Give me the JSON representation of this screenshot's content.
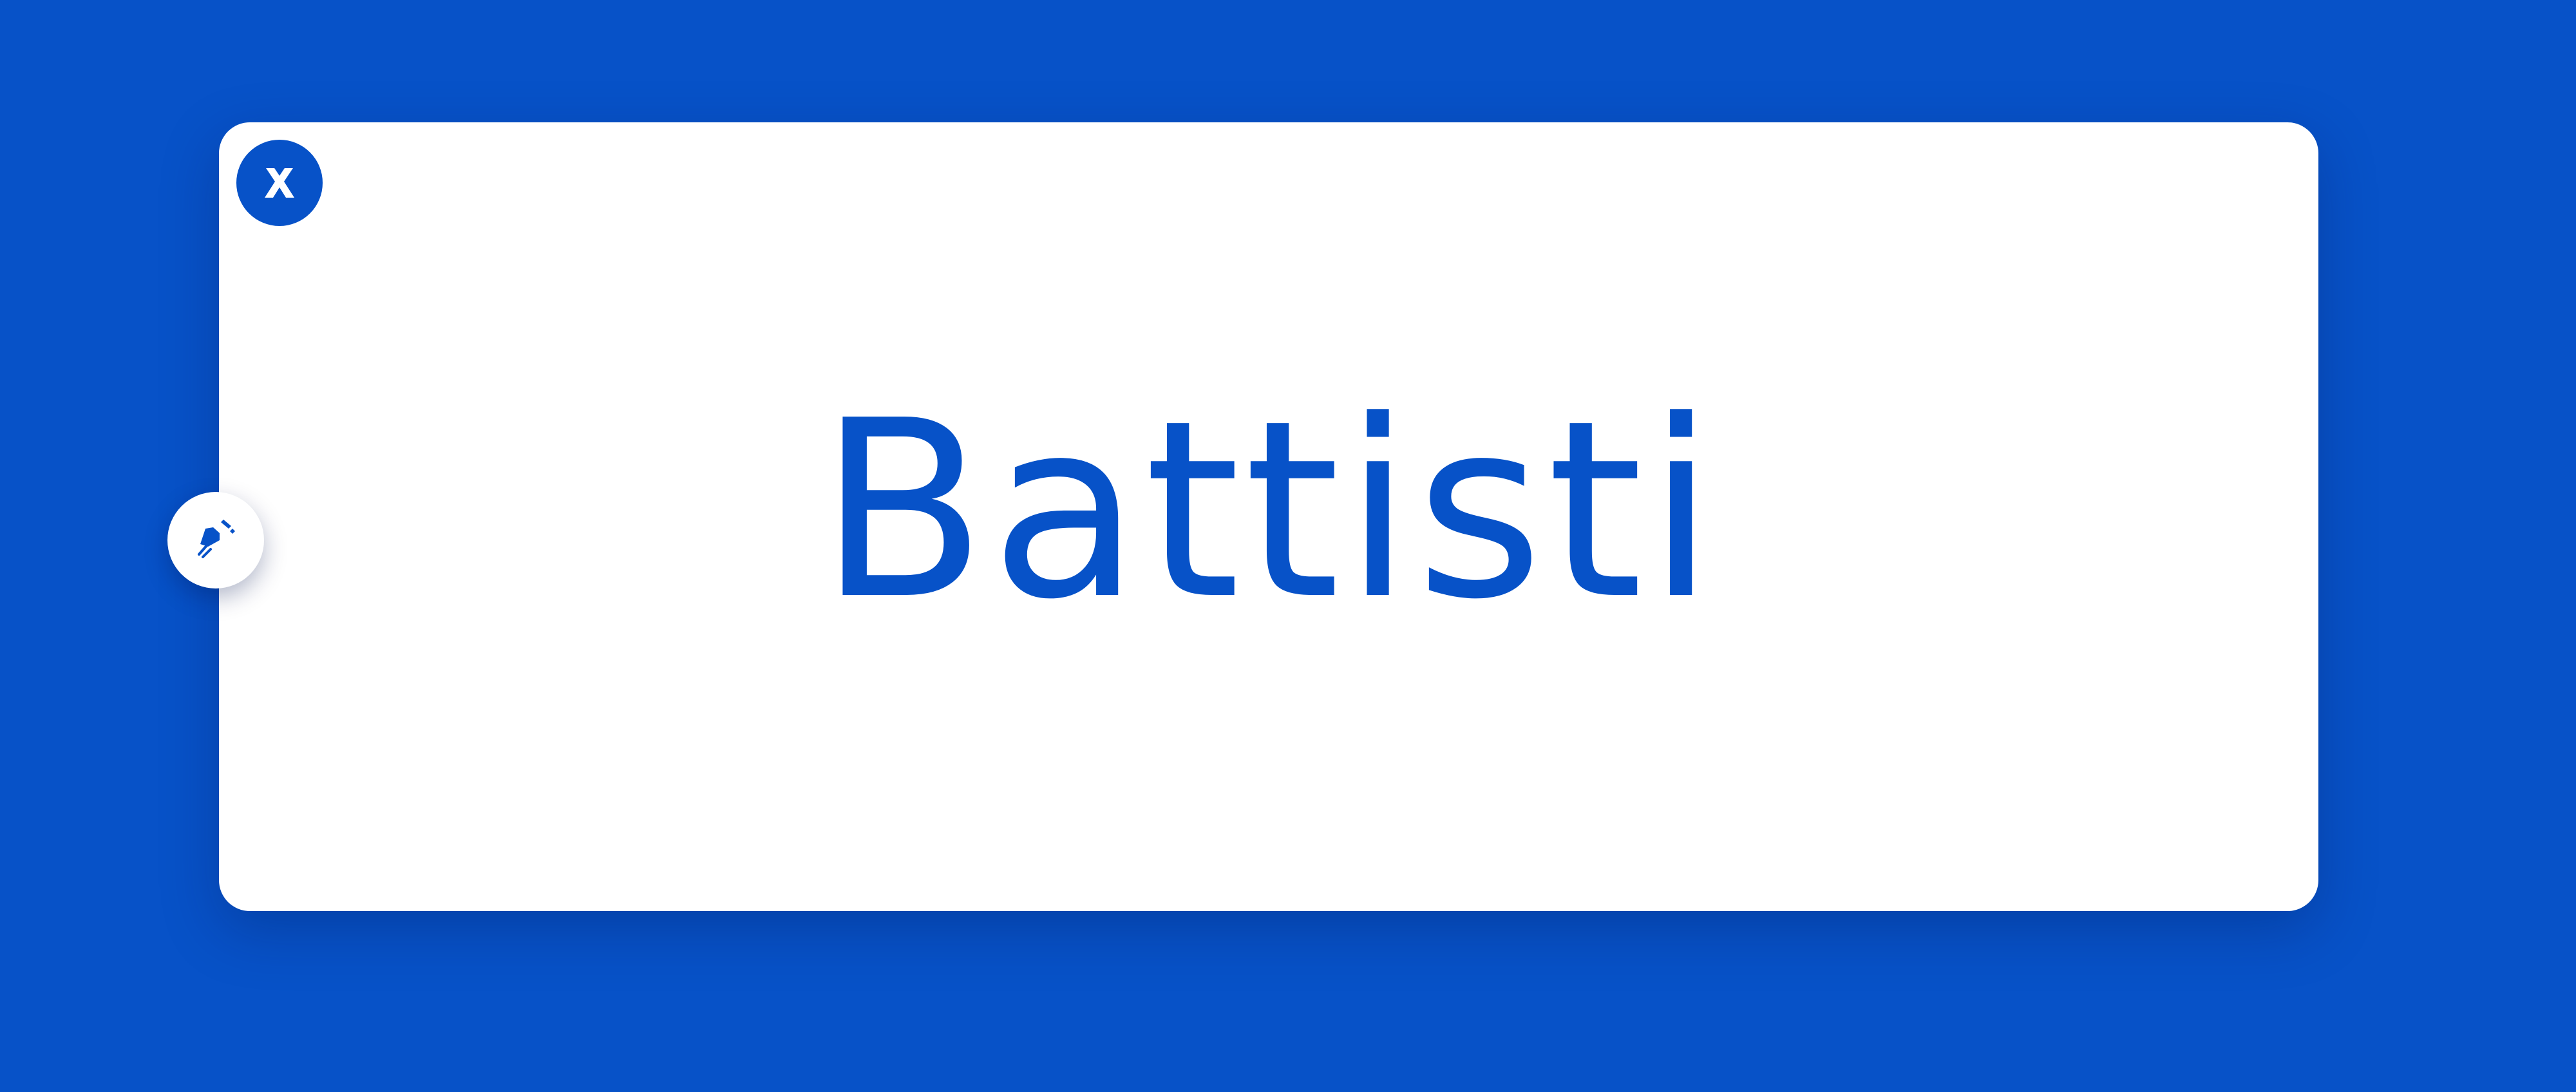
{
  "page": {
    "background_color": "#0752C8"
  },
  "card": {
    "background_color": "#FFFFFF"
  },
  "close_button": {
    "icon": "close-icon",
    "color": "#0752C8"
  },
  "edit_button": {
    "icon": "pen-nib-icon",
    "color": "#0752C8"
  },
  "logo": {
    "text": "Battisti",
    "color": "#0752C8"
  }
}
